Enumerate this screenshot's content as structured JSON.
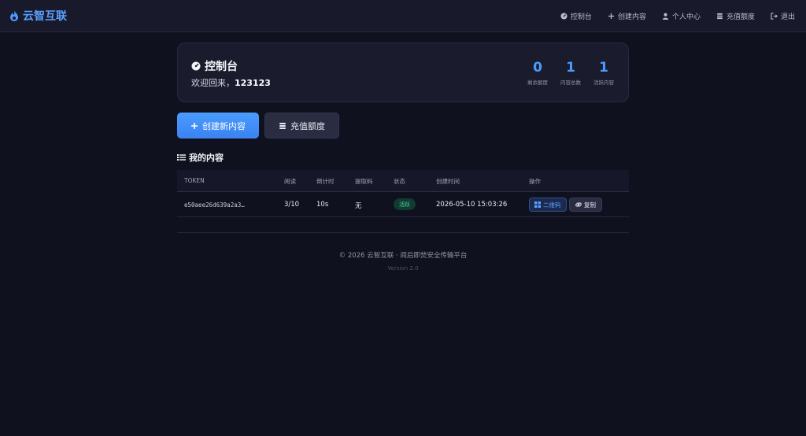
{
  "nav": {
    "brand": "云智互联",
    "links": [
      {
        "label": "控制台",
        "icon": "dashboard-icon"
      },
      {
        "label": "创建内容",
        "icon": "plus-icon"
      },
      {
        "label": "个人中心",
        "icon": "user-icon"
      },
      {
        "label": "充值额度",
        "icon": "coins-icon"
      },
      {
        "label": "退出",
        "icon": "logout-icon"
      }
    ]
  },
  "header": {
    "title": "控制台",
    "welcome_prefix": "欢迎回来，",
    "username": "123123",
    "stats": [
      {
        "value": "0",
        "label": "剩余额度"
      },
      {
        "value": "1",
        "label": "内容总数"
      },
      {
        "value": "1",
        "label": "活跃内容"
      }
    ]
  },
  "actions": {
    "create_label": "创建新内容",
    "recharge_label": "充值额度"
  },
  "content": {
    "section_title": "我的内容",
    "columns": [
      "TOKEN",
      "阅读",
      "倒计时",
      "提取码",
      "状态",
      "创建时间",
      "操作"
    ],
    "rows": [
      {
        "token": "e50aee26d639a2a3…",
        "reads": "3/10",
        "countdown": "10s",
        "code": "无",
        "status": "活跃",
        "created": "2026-05-10 15:03:26",
        "qr_label": "二维码",
        "copy_label": "复制"
      }
    ]
  },
  "footer": {
    "copyright": "© 2026 云智互联 · 阅后即焚安全传输平台",
    "version": "Version 2.0"
  },
  "colors": {
    "accent": "#4c9bff",
    "background": "#10111f",
    "card": "#1a1c2e",
    "success": "#3fd69a"
  }
}
